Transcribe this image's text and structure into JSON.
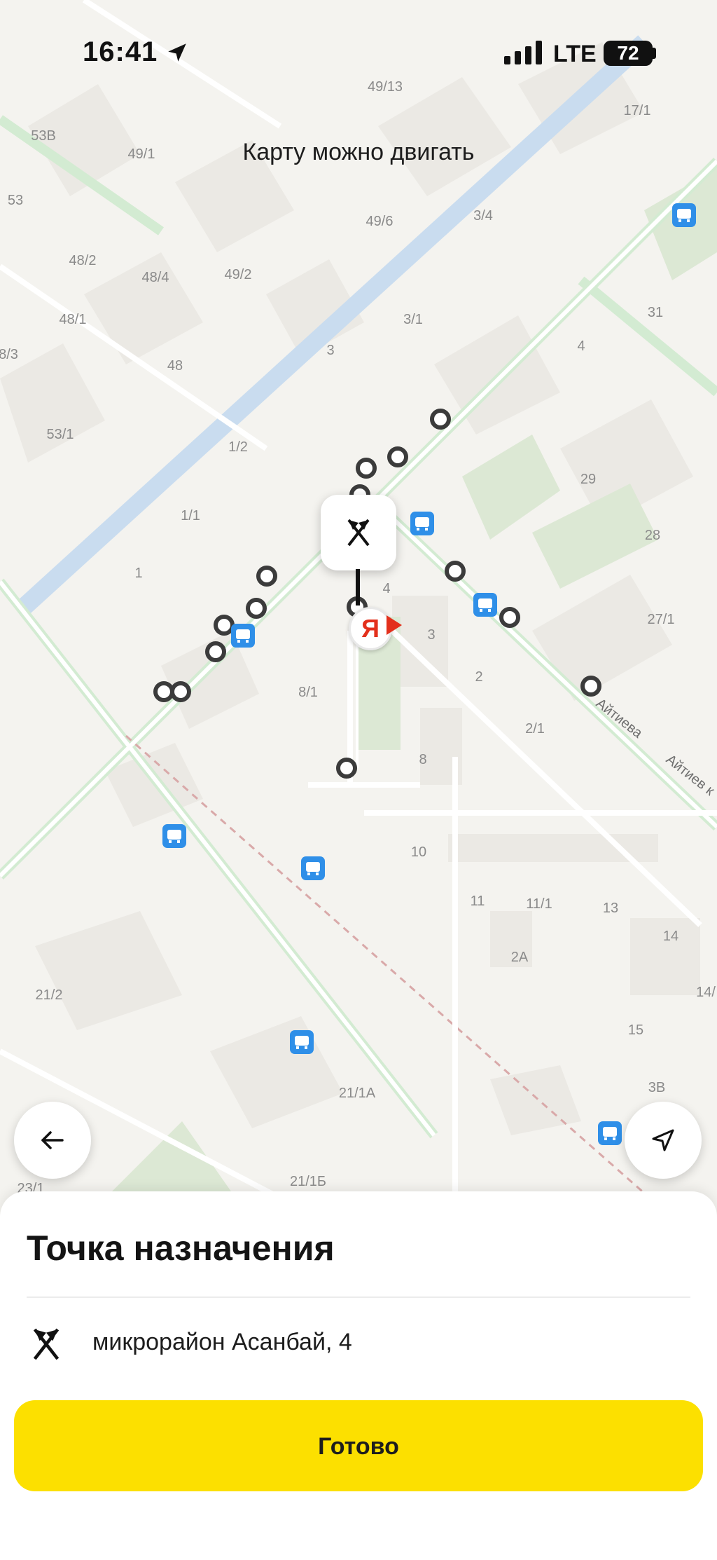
{
  "status_bar": {
    "time": "16:41",
    "network": "LTE",
    "battery": "72"
  },
  "hint": "Карту можно двигать",
  "map": {
    "colors": {
      "background": "#f4f3ef",
      "road": "#ffffff",
      "green_road": "#cfe8cf",
      "canal": "#c9dcef",
      "park": "#dde9d6",
      "building": "#e9e7e2",
      "label": "#8a8a8a",
      "pin_marker": "#3a3a3a",
      "bus_stop": "#2f8fe8"
    },
    "labels": [
      {
        "text": "49/13"
      },
      {
        "text": "17/1"
      },
      {
        "text": "53В"
      },
      {
        "text": "49/1"
      },
      {
        "text": "53"
      },
      {
        "text": "3/4"
      },
      {
        "text": "49/6"
      },
      {
        "text": "48/2"
      },
      {
        "text": "48/4"
      },
      {
        "text": "49/2"
      },
      {
        "text": "48/1"
      },
      {
        "text": "3/1"
      },
      {
        "text": "31"
      },
      {
        "text": "8/3"
      },
      {
        "text": "3"
      },
      {
        "text": "4"
      },
      {
        "text": "48"
      },
      {
        "text": "53/1"
      },
      {
        "text": "1/2"
      },
      {
        "text": "29"
      },
      {
        "text": "1/1"
      },
      {
        "text": "28"
      },
      {
        "text": "1"
      },
      {
        "text": "4"
      },
      {
        "text": "27/1"
      },
      {
        "text": "3"
      },
      {
        "text": "2"
      },
      {
        "text": "8/1"
      },
      {
        "text": "2/1"
      },
      {
        "text": "8"
      },
      {
        "text": "10"
      },
      {
        "text": "11"
      },
      {
        "text": "11/1"
      },
      {
        "text": "13"
      },
      {
        "text": "14"
      },
      {
        "text": "2А"
      },
      {
        "text": "14/"
      },
      {
        "text": "21/2"
      },
      {
        "text": "15"
      },
      {
        "text": "3В"
      },
      {
        "text": "21/1А"
      },
      {
        "text": "21/1Б"
      },
      {
        "text": "23/1"
      }
    ],
    "street_labels": [
      "Айтиева",
      "Айтиев к"
    ],
    "pickup_points": 17,
    "bus_stops": 8
  },
  "back_button_icon": "arrow-left-icon",
  "locate_button_icon": "navigation-arrow-icon",
  "pin_icon": "crossed-flags-icon",
  "brand_badge": "Я",
  "sheet": {
    "title": "Точка назначения",
    "destination_icon": "crossed-flags-icon",
    "destination": "микрорайон Асанбай, 4",
    "done_label": "Готово",
    "accent": "#fce000"
  }
}
